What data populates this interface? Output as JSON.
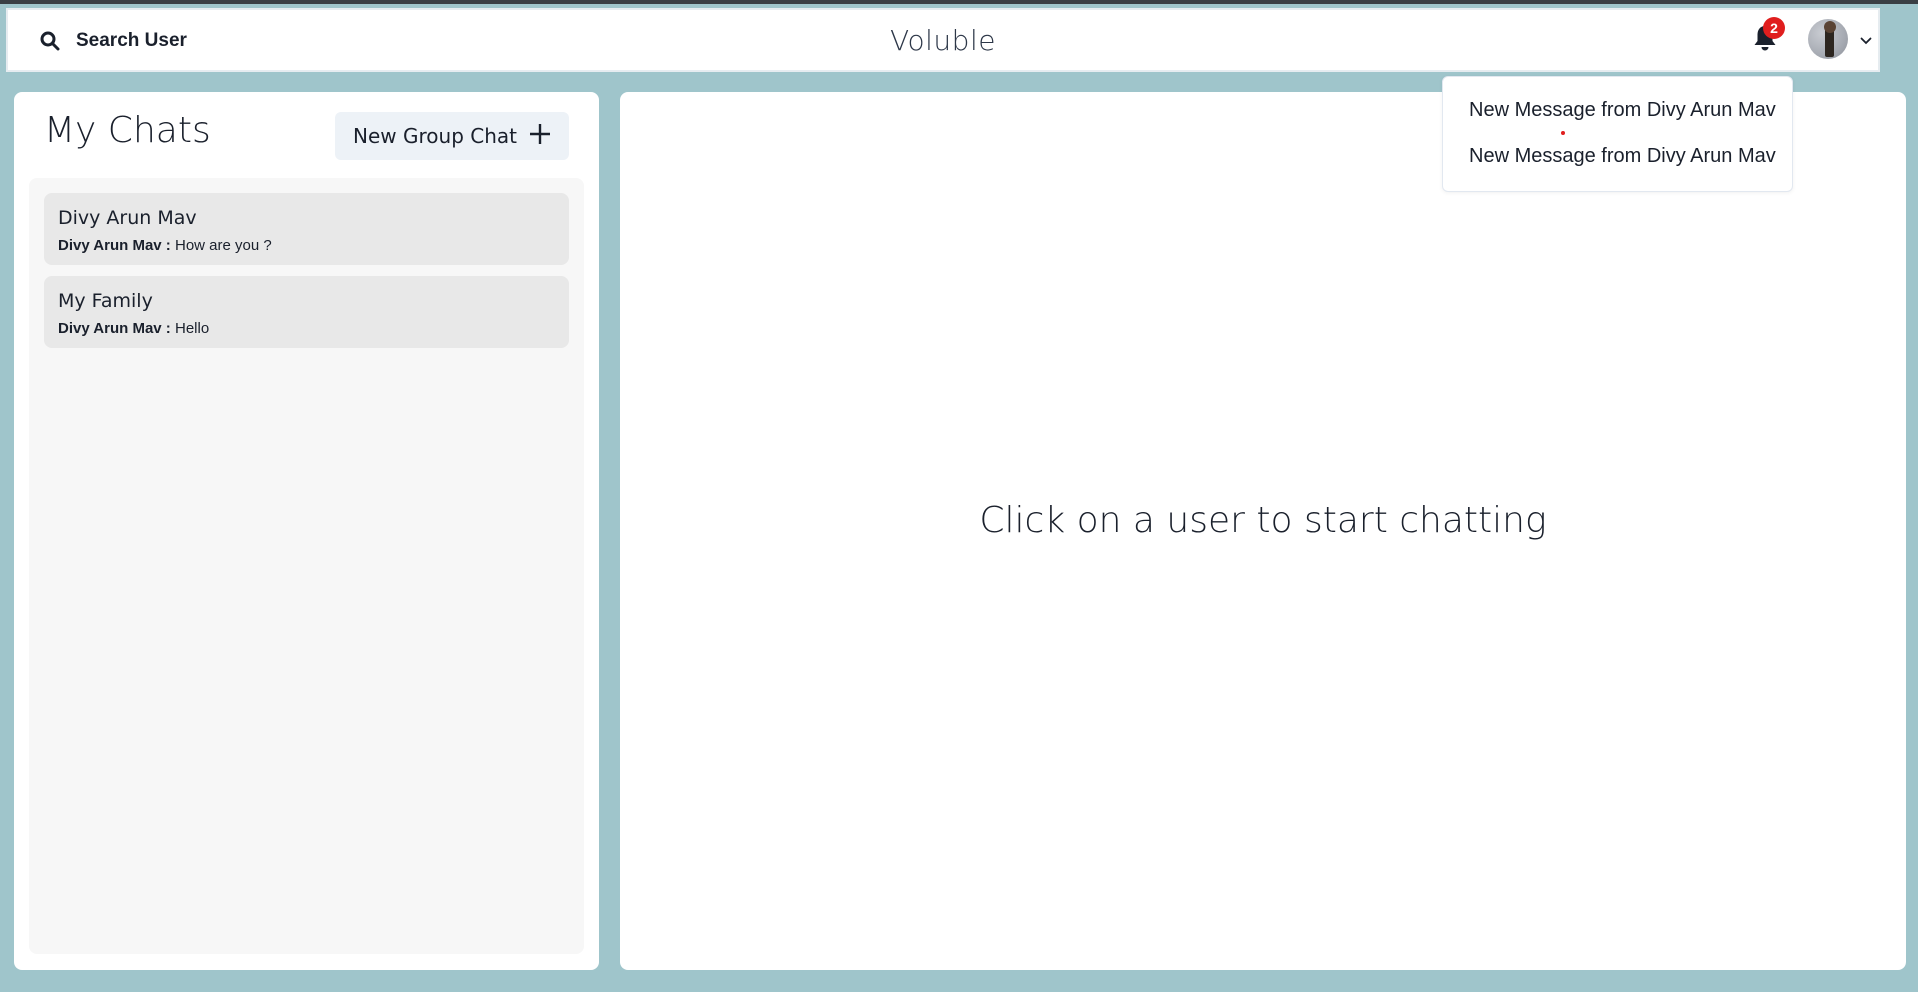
{
  "header": {
    "search_label": "Search User",
    "app_title": "Voluble",
    "notification_count": "2",
    "icons": [
      "search-icon",
      "bell-icon",
      "chevron-down-icon"
    ],
    "badge_color": "#e01e1e"
  },
  "sidebar": {
    "title": "My Chats",
    "new_group_label": "New Group Chat",
    "chats": [
      {
        "name": "Divy Arun Mav",
        "sender": "Divy Arun Mav :",
        "message": "How are you ?"
      },
      {
        "name": "My Family",
        "sender": "Divy Arun Mav :",
        "message": "Hello"
      }
    ]
  },
  "main": {
    "placeholder": "Click on a user to start chatting"
  },
  "notifications": {
    "items": [
      {
        "text": "New Message from Divy Arun Mav"
      },
      {
        "text": "New Message from Divy Arun Mav"
      }
    ]
  },
  "colors": {
    "background": "#9fc5cb",
    "panel": "#ffffff",
    "chat_item": "#e8e8e8",
    "button": "#edf2f7"
  }
}
